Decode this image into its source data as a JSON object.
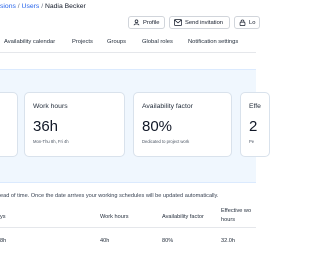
{
  "breadcrumb": {
    "partial_link": "sions",
    "separator1": "/",
    "users_link": "Users",
    "separator2": "/",
    "current": "Nadia Becker"
  },
  "header_buttons": {
    "profile": "Profile",
    "send_invitation": "Send invitation",
    "partial": "Lo"
  },
  "tabs": [
    "Availability calendar",
    "Projects",
    "Groups",
    "Global roles",
    "Notification settings"
  ],
  "cards": [
    {
      "label": "Work hours",
      "value": "36h",
      "sub": "Mon-Thu 8h, Fri 4h"
    },
    {
      "label": "Availability factor",
      "value": "80%",
      "sub": "Dedicated to project work"
    },
    {
      "label": "Effe",
      "value": "2",
      "sub": "Pe"
    }
  ],
  "note": "ead of time. Once the date arrives your working schedules will be updated automatically.",
  "table": {
    "headers": {
      "c1": "ys",
      "work_hours": "Work hours",
      "availability_factor": "Availability factor",
      "effective_line1": "Effective wo",
      "effective_line2": "hours"
    },
    "row": {
      "c1": "8h",
      "work_hours": "40h",
      "availability_factor": "80%",
      "effective": "32.0h"
    }
  },
  "colors": {
    "link": "#2563eb",
    "band_background": "#f0f7fe"
  }
}
